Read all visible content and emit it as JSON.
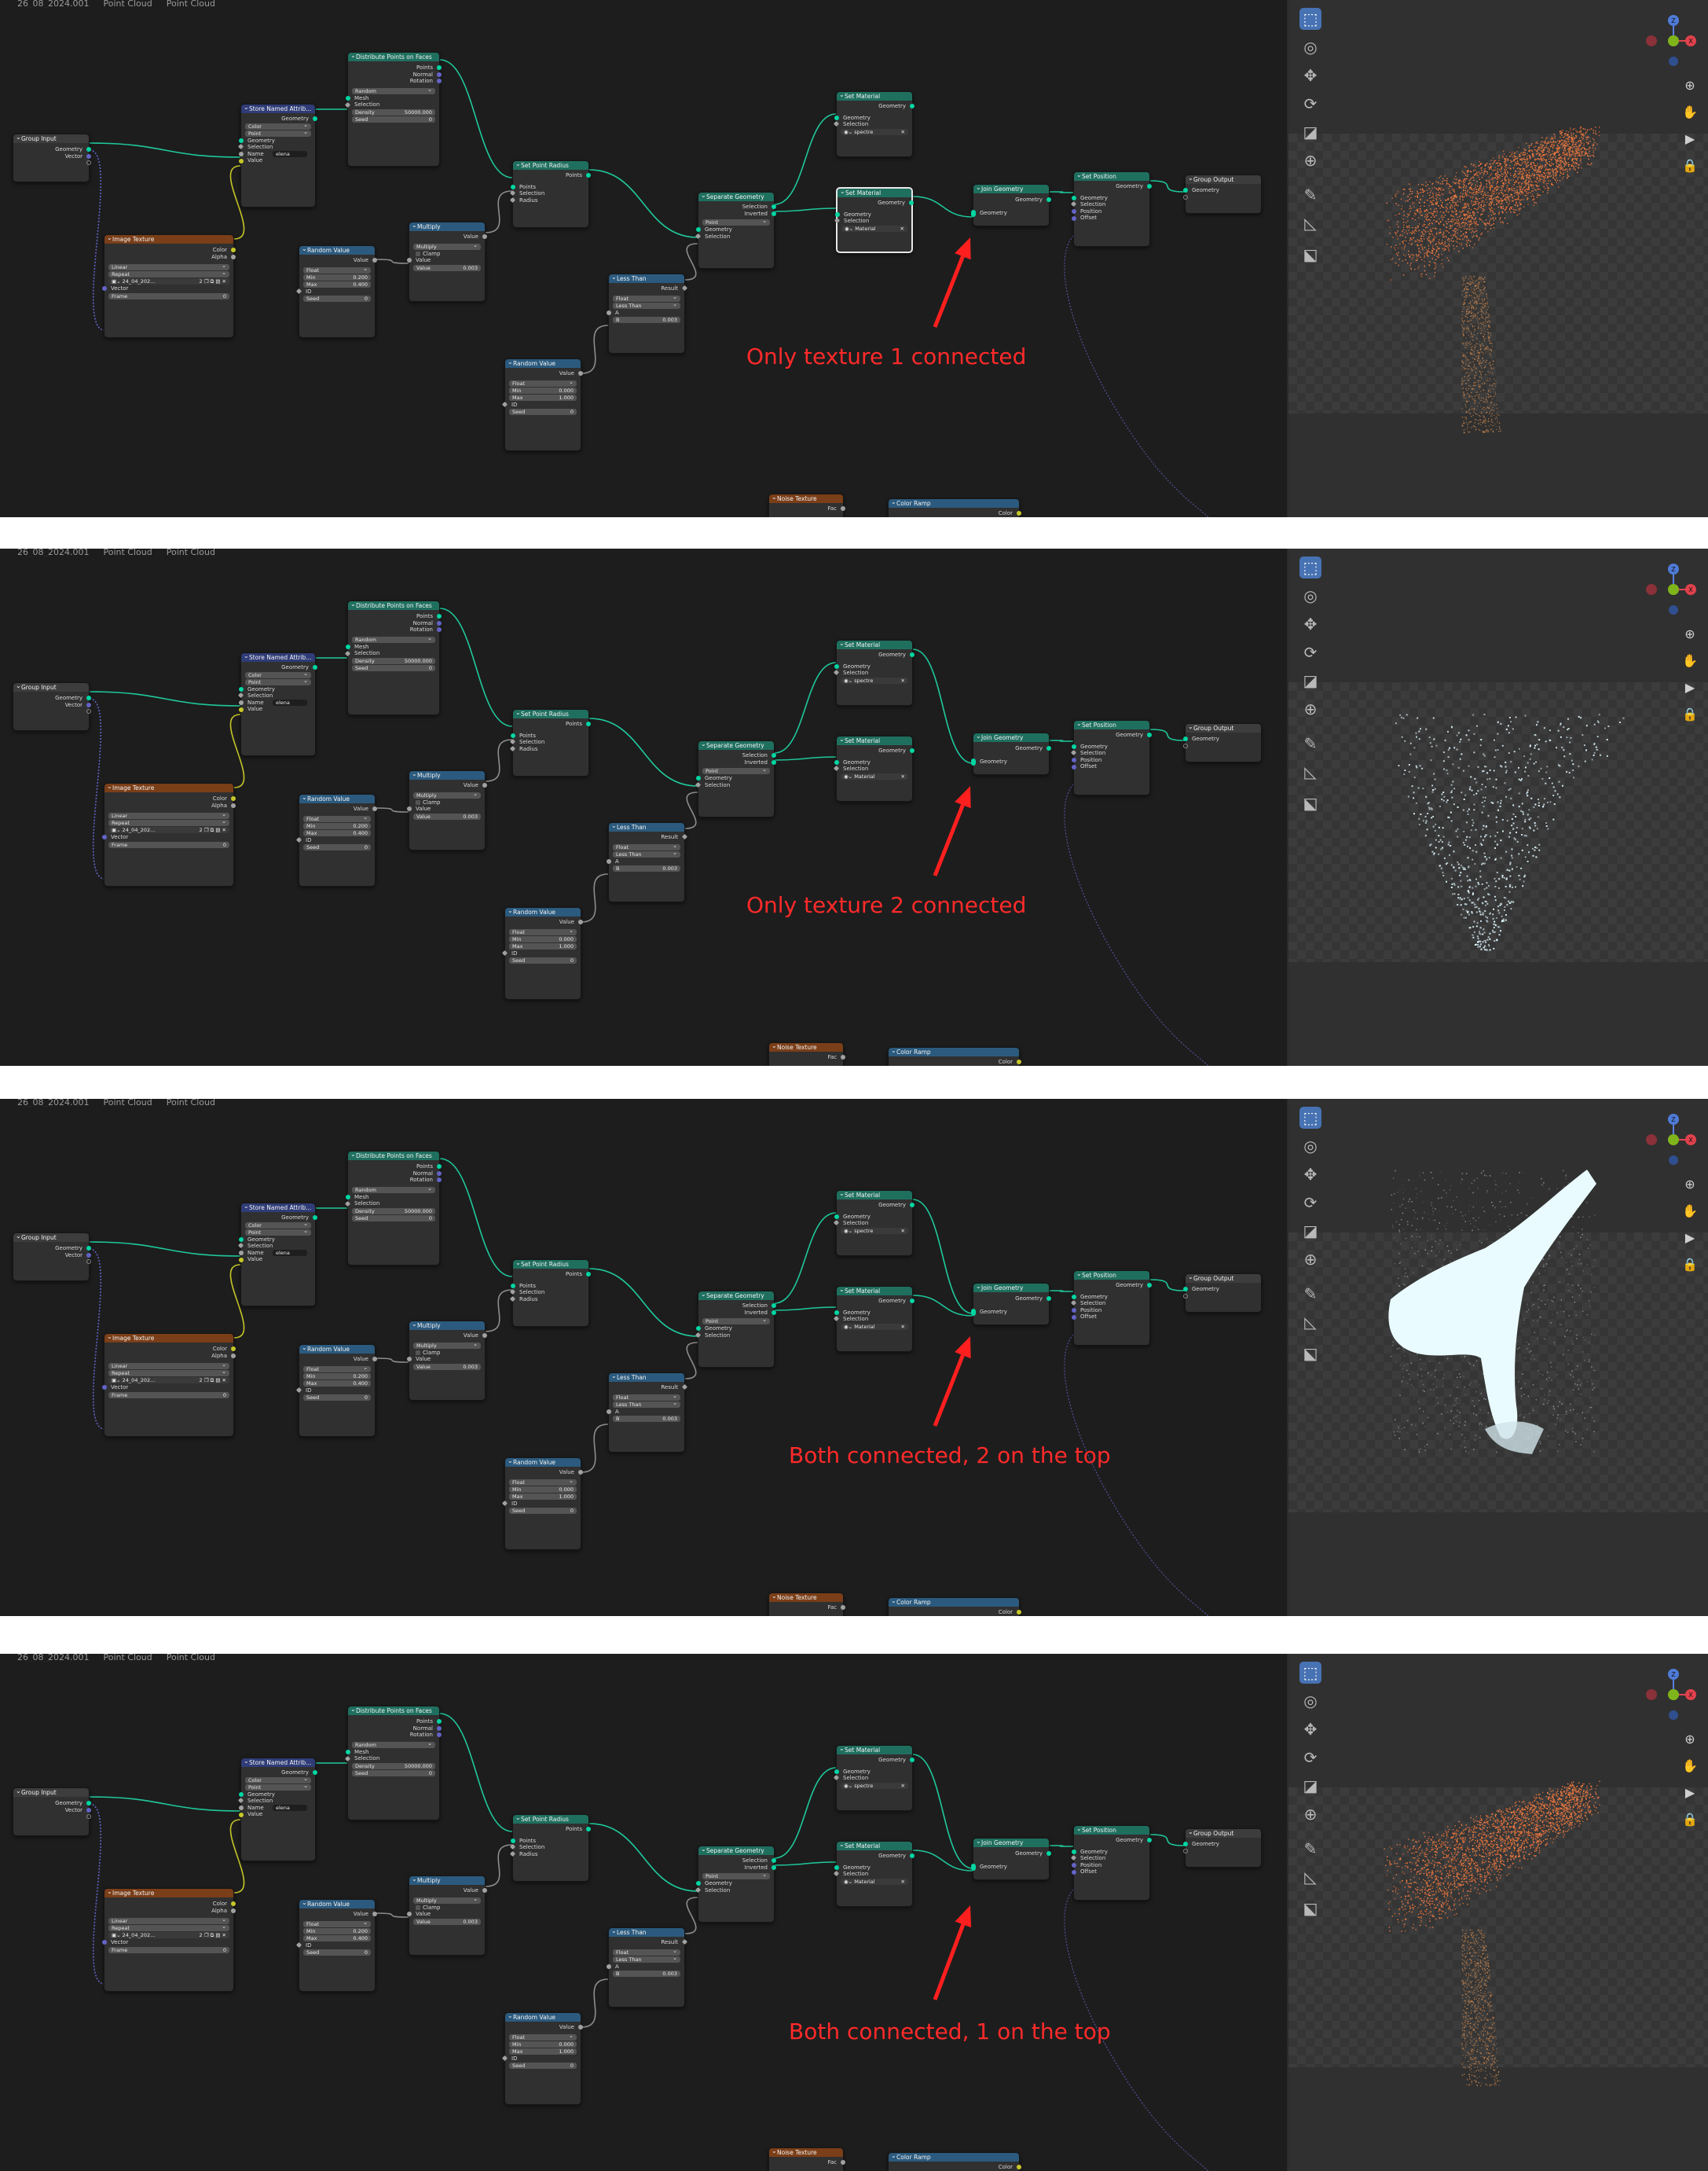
{
  "breadcrumb": {
    "panel1": [
      "26_08_2024.001",
      "Point Cloud",
      "Point Cloud"
    ],
    "panel2": [
      "26_08_2024.001",
      "Point Cloud",
      "Point Cloud"
    ],
    "panel3": [
      "26_08_2024.001",
      "Point Cloud",
      "Point Cloud"
    ],
    "panel4": [
      "26_08_2024.001",
      "Point Cloud",
      "Point Cloud"
    ]
  },
  "annotations": [
    "Only texture 1 connected",
    "Only texture 2 connected",
    "Both connected, 2 on the top",
    "Both connected, 1 on the top"
  ],
  "nodes": {
    "group_input": {
      "title": "Group Input",
      "geometry": "Geometry",
      "vector": "Vector"
    },
    "image_texture": {
      "title": "Image Texture",
      "color": "Color",
      "alpha": "Alpha",
      "interp": "Linear",
      "ext": "Repeat",
      "image": "24_04_202...",
      "users": "2",
      "vector": "Vector",
      "frame": "Frame",
      "frame_val": "0"
    },
    "store_named": {
      "title": "Store Named Attrib...",
      "geometry_out": "Geometry",
      "type": "Color",
      "domain": "Point",
      "geometry": "Geometry",
      "selection": "Selection",
      "name_label": "Name",
      "name_val": "elena",
      "value": "Value"
    },
    "distribute": {
      "title": "Distribute Points on Faces",
      "points": "Points",
      "normal": "Normal",
      "rotation": "Rotation",
      "mode": "Random",
      "mesh": "Mesh",
      "selection": "Selection",
      "density_label": "Density",
      "density_val": "50000.000",
      "seed_label": "Seed",
      "seed_val": "0"
    },
    "random1": {
      "title": "Random Value",
      "value": "Value",
      "type": "Float",
      "min_label": "Min",
      "min_val": "0.200",
      "max_label": "Max",
      "max_val": "0.400",
      "id": "ID",
      "seed_label": "Seed",
      "seed_val": "0"
    },
    "multiply": {
      "title": "Multiply",
      "value_out": "Value",
      "op": "Multiply",
      "clamp": "Clamp",
      "value": "Value",
      "value2_label": "Value",
      "value2_val": "0.003"
    },
    "set_radius": {
      "title": "Set Point Radius",
      "points_out": "Points",
      "points": "Points",
      "selection": "Selection",
      "radius": "Radius"
    },
    "less_than": {
      "title": "Less Than",
      "result": "Result",
      "type": "Float",
      "op": "Less Than",
      "a": "A",
      "b_label": "B",
      "b_val": "0.003"
    },
    "random2": {
      "title": "Random Value",
      "value": "Value",
      "type": "Float",
      "min_label": "Min",
      "min_val": "0.000",
      "max_label": "Max",
      "max_val": "1.000",
      "id": "ID",
      "seed_label": "Seed",
      "seed_val": "0"
    },
    "separate": {
      "title": "Separate Geometry",
      "selection_out": "Selection",
      "inverted": "Inverted",
      "domain": "Point",
      "geometry": "Geometry",
      "selection": "Selection"
    },
    "set_mat1": {
      "title": "Set Material",
      "geometry_out": "Geometry",
      "geometry": "Geometry",
      "selection": "Selection",
      "material": "spectre"
    },
    "set_mat2": {
      "title": "Set Material",
      "geometry_out": "Geometry",
      "geometry": "Geometry",
      "selection": "Selection",
      "material": "Material"
    },
    "join": {
      "title": "Join Geometry",
      "geometry_out": "Geometry",
      "geometry": "Geometry"
    },
    "set_position": {
      "title": "Set Position",
      "geometry_out": "Geometry",
      "geometry": "Geometry",
      "selection": "Selection",
      "position": "Position",
      "offset": "Offset"
    },
    "group_output": {
      "title": "Group Output",
      "geometry": "Geometry"
    },
    "noise": {
      "title": "Noise Texture",
      "fac": "Fac"
    },
    "color_ramp": {
      "title": "Color Ramp",
      "color": "Color"
    }
  },
  "viewport": {
    "gizmo": {
      "z": "Z",
      "x": "X",
      "y": "Y"
    },
    "tool_icons": [
      "select-box-icon",
      "cursor-icon",
      "move-icon",
      "rotate-icon",
      "scale-icon",
      "transform-icon",
      "annotate-icon",
      "measure-icon",
      "add-cube-icon"
    ],
    "nav_icons": [
      "zoom-icon",
      "hand-pan-icon",
      "camera-icon",
      "lock-icon"
    ],
    "colors": {
      "orange_cloud": "#c8844c",
      "white_cloud": "#e9fbff",
      "sparse_points": "#dff6ff"
    }
  }
}
